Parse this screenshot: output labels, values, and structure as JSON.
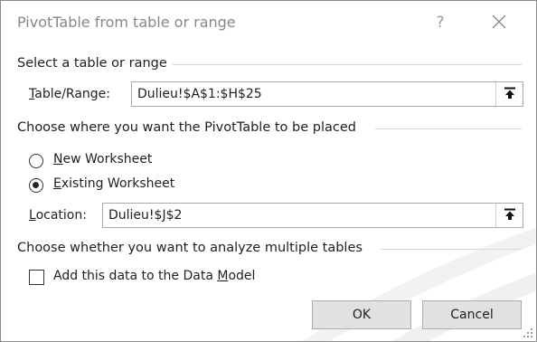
{
  "dialog": {
    "title": "PivotTable from table or range",
    "help_glyph": "?",
    "close_icon": "close-icon"
  },
  "source": {
    "section_label": "Select a table or range",
    "table_range_label_pre": "",
    "table_range_label_ul": "T",
    "table_range_label_post": "able/Range:",
    "table_range_value": "Dulieu!$A$1:$H$25",
    "collapse_icon": "collapse-dialog-icon"
  },
  "placement": {
    "section_label": "Choose where you want the PivotTable to be placed",
    "new_ws_ul": "N",
    "new_ws_rest": "ew Worksheet",
    "new_ws_selected": false,
    "existing_ws_ul": "E",
    "existing_ws_rest": "xisting Worksheet",
    "existing_ws_selected": true,
    "location_label_ul": "L",
    "location_label_rest": "ocation:",
    "location_value": "Dulieu!$J$2"
  },
  "multiple": {
    "section_label": "Choose whether you want to analyze multiple tables",
    "data_model_pre": "Add this data to the Data ",
    "data_model_ul": "M",
    "data_model_post": "odel",
    "data_model_checked": false
  },
  "buttons": {
    "ok": "OK",
    "cancel": "Cancel"
  },
  "colors": {
    "title_text": "#888888",
    "button_face": "#e1e1e1",
    "border": "#a9a9a9"
  }
}
